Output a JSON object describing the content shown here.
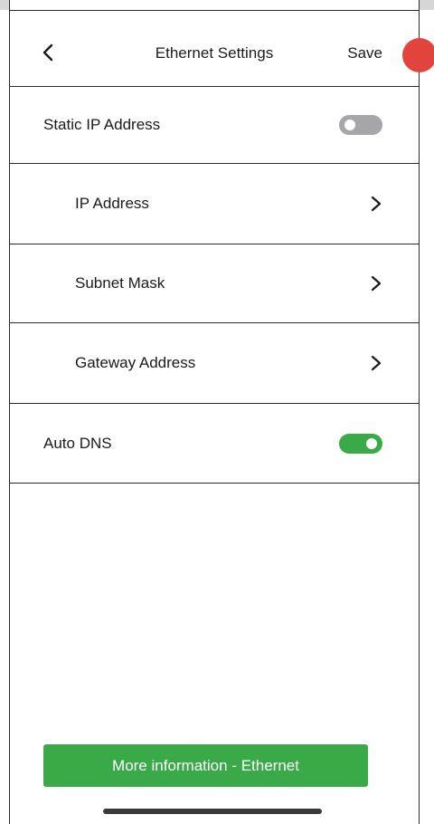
{
  "header": {
    "back_icon": "chevron-left-icon",
    "title": "Ethernet Settings",
    "save_label": "Save"
  },
  "settings": {
    "static_ip": {
      "label": "Static IP Address",
      "toggle_on": false
    },
    "ip_address": {
      "label": "IP Address",
      "icon": "chevron-right-icon"
    },
    "subnet_mask": {
      "label": "Subnet Mask",
      "icon": "chevron-right-icon"
    },
    "gateway_address": {
      "label": "Gateway Address",
      "icon": "chevron-right-icon"
    },
    "auto_dns": {
      "label": "Auto DNS",
      "toggle_on": true
    }
  },
  "footer": {
    "more_info_label": "More information - Ethernet"
  },
  "colors": {
    "accent_green": "#3aa948",
    "toggle_off": "#a6a6a8",
    "record_dot": "#e0443c",
    "divider": "#2a2a2a"
  }
}
